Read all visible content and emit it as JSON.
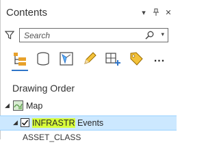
{
  "pane": {
    "title": "Contents"
  },
  "search": {
    "placeholder": "Search",
    "value": ""
  },
  "toolbar": {
    "tools": [
      {
        "icon": "list-by-drawing-order-icon",
        "selected": true
      },
      {
        "icon": "list-by-source-icon"
      },
      {
        "icon": "list-by-selection-icon"
      },
      {
        "icon": "list-by-editing-icon"
      },
      {
        "icon": "list-by-snapping-icon"
      },
      {
        "icon": "list-by-labeling-icon"
      }
    ],
    "more_label": "..."
  },
  "section": {
    "heading": "Drawing Order"
  },
  "tree": {
    "map_label": "Map",
    "layer": {
      "highlighted_text": "INFRASTR",
      "rest_text": " Events",
      "checked": true
    },
    "next_row_partial": "ASSET_CLASS"
  },
  "colors": {
    "selection_bg": "#cce8ff",
    "text_highlight": "#d8ff3a",
    "accent": "#2e74c8"
  }
}
